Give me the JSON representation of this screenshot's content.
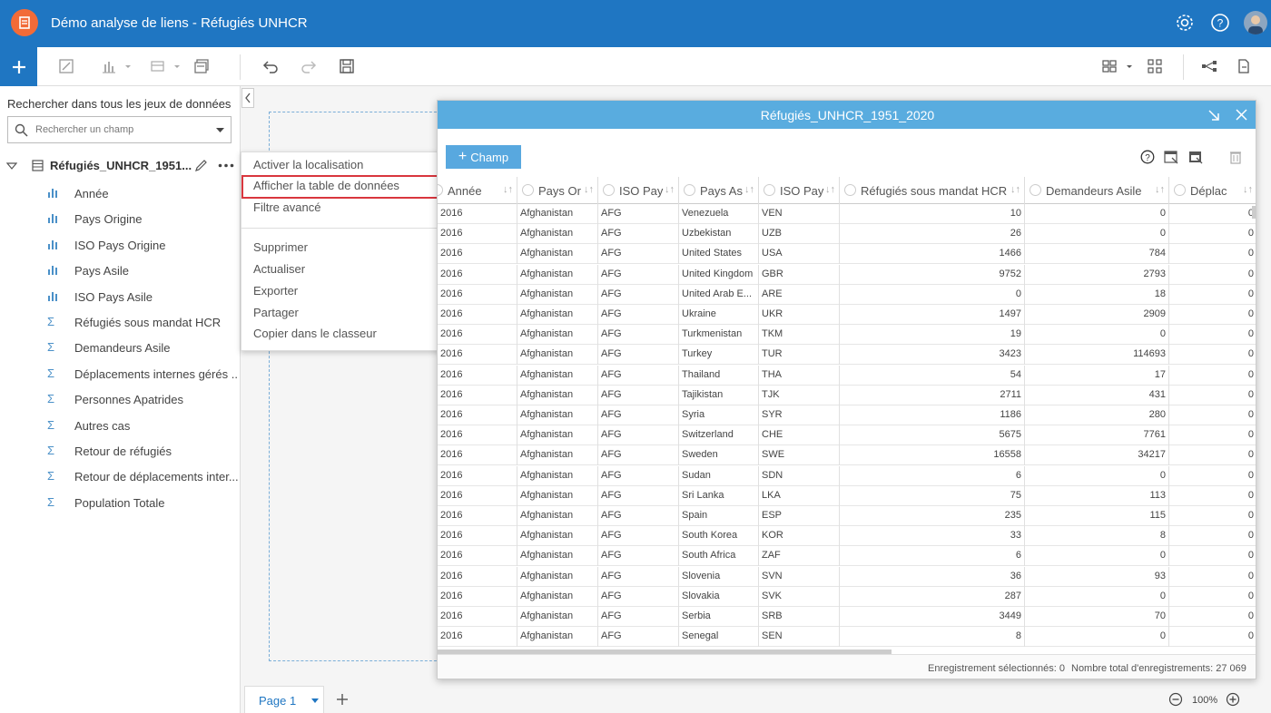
{
  "app": {
    "title": "Démo analyse de liens - Réfugiés UNHCR"
  },
  "sidebar": {
    "search_label": "Rechercher dans tous les jeux de données",
    "search_placeholder": "Rechercher un champ",
    "dataset_name": "Réfugiés_UNHCR_1951...",
    "fields": [
      {
        "label": "Année",
        "type": "string"
      },
      {
        "label": "Pays Origine",
        "type": "string"
      },
      {
        "label": "ISO Pays Origine",
        "type": "string"
      },
      {
        "label": "Pays Asile",
        "type": "string"
      },
      {
        "label": "ISO Pays Asile",
        "type": "string"
      },
      {
        "label": "Réfugiés sous mandat HCR",
        "type": "number"
      },
      {
        "label": "Demandeurs Asile",
        "type": "number"
      },
      {
        "label": "Déplacements internes gérés ...",
        "type": "number"
      },
      {
        "label": "Personnes Apatrides",
        "type": "number"
      },
      {
        "label": "Autres cas",
        "type": "number"
      },
      {
        "label": "Retour de réfugiés",
        "type": "number"
      },
      {
        "label": "Retour de déplacements inter...",
        "type": "number"
      },
      {
        "label": "Population Totale",
        "type": "number"
      }
    ]
  },
  "context_menu": {
    "items": [
      "Activer la localisation",
      "Afficher la table de données",
      "Filtre avancé"
    ],
    "items2": [
      "Supprimer",
      "Actualiser",
      "Exporter",
      "Partager",
      "Copier dans le classeur"
    ]
  },
  "data_table": {
    "title": "Réfugiés_UNHCR_1951_2020",
    "add_field_label": "Champ",
    "columns": [
      "Année",
      "Pays Or",
      "ISO Pay",
      "Pays As",
      "ISO Pay",
      "Réfugiés sous mandat HCR",
      "Demandeurs Asile",
      "Déplac"
    ],
    "rows": [
      [
        "2016",
        "Afghanistan",
        "AFG",
        "Venezuela",
        "VEN",
        "10",
        "0",
        "0"
      ],
      [
        "2016",
        "Afghanistan",
        "AFG",
        "Uzbekistan",
        "UZB",
        "26",
        "0",
        "0"
      ],
      [
        "2016",
        "Afghanistan",
        "AFG",
        "United States",
        "USA",
        "1466",
        "784",
        "0"
      ],
      [
        "2016",
        "Afghanistan",
        "AFG",
        "United Kingdom",
        "GBR",
        "9752",
        "2793",
        "0"
      ],
      [
        "2016",
        "Afghanistan",
        "AFG",
        "United Arab E...",
        "ARE",
        "0",
        "18",
        "0"
      ],
      [
        "2016",
        "Afghanistan",
        "AFG",
        "Ukraine",
        "UKR",
        "1497",
        "2909",
        "0"
      ],
      [
        "2016",
        "Afghanistan",
        "AFG",
        "Turkmenistan",
        "TKM",
        "19",
        "0",
        "0"
      ],
      [
        "2016",
        "Afghanistan",
        "AFG",
        "Turkey",
        "TUR",
        "3423",
        "114693",
        "0"
      ],
      [
        "2016",
        "Afghanistan",
        "AFG",
        "Thailand",
        "THA",
        "54",
        "17",
        "0"
      ],
      [
        "2016",
        "Afghanistan",
        "AFG",
        "Tajikistan",
        "TJK",
        "2711",
        "431",
        "0"
      ],
      [
        "2016",
        "Afghanistan",
        "AFG",
        "Syria",
        "SYR",
        "1186",
        "280",
        "0"
      ],
      [
        "2016",
        "Afghanistan",
        "AFG",
        "Switzerland",
        "CHE",
        "5675",
        "7761",
        "0"
      ],
      [
        "2016",
        "Afghanistan",
        "AFG",
        "Sweden",
        "SWE",
        "16558",
        "34217",
        "0"
      ],
      [
        "2016",
        "Afghanistan",
        "AFG",
        "Sudan",
        "SDN",
        "6",
        "0",
        "0"
      ],
      [
        "2016",
        "Afghanistan",
        "AFG",
        "Sri Lanka",
        "LKA",
        "75",
        "113",
        "0"
      ],
      [
        "2016",
        "Afghanistan",
        "AFG",
        "Spain",
        "ESP",
        "235",
        "115",
        "0"
      ],
      [
        "2016",
        "Afghanistan",
        "AFG",
        "South Korea",
        "KOR",
        "33",
        "8",
        "0"
      ],
      [
        "2016",
        "Afghanistan",
        "AFG",
        "South Africa",
        "ZAF",
        "6",
        "0",
        "0"
      ],
      [
        "2016",
        "Afghanistan",
        "AFG",
        "Slovenia",
        "SVN",
        "36",
        "93",
        "0"
      ],
      [
        "2016",
        "Afghanistan",
        "AFG",
        "Slovakia",
        "SVK",
        "287",
        "0",
        "0"
      ],
      [
        "2016",
        "Afghanistan",
        "AFG",
        "Serbia",
        "SRB",
        "3449",
        "70",
        "0"
      ],
      [
        "2016",
        "Afghanistan",
        "AFG",
        "Senegal",
        "SEN",
        "8",
        "0",
        "0"
      ]
    ],
    "footer_selected": "Enregistrement sélectionnés: 0",
    "footer_total": "Nombre total d'enregistrements: 27 069"
  },
  "pagebar": {
    "page_label": "Page 1",
    "zoom": "100%"
  },
  "colors": {
    "header": "#1f76c2",
    "table_header": "#59acdf",
    "highlight": "#d9363e",
    "logo": "#f26b38"
  }
}
